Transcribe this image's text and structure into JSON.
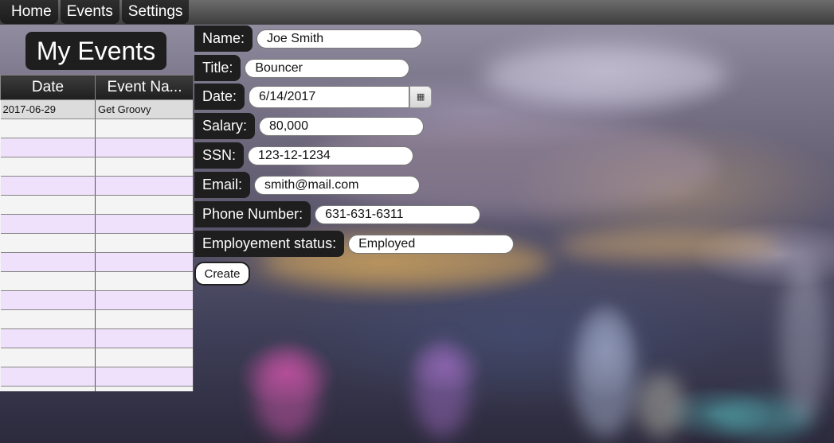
{
  "nav": {
    "items": [
      {
        "label": "Home"
      },
      {
        "label": "Events"
      },
      {
        "label": "Settings"
      }
    ]
  },
  "sidebar": {
    "title": "My Events",
    "table": {
      "headers": [
        "Date",
        "Event Na..."
      ],
      "rows": [
        [
          "2017-06-29",
          "Get Groovy"
        ],
        [
          "",
          ""
        ],
        [
          "",
          ""
        ],
        [
          "",
          ""
        ],
        [
          "",
          ""
        ],
        [
          "",
          ""
        ],
        [
          "",
          ""
        ],
        [
          "",
          ""
        ],
        [
          "",
          ""
        ],
        [
          "",
          ""
        ],
        [
          "",
          ""
        ],
        [
          "",
          ""
        ],
        [
          "",
          ""
        ],
        [
          "",
          ""
        ],
        [
          "",
          ""
        ],
        [
          "",
          ""
        ]
      ]
    }
  },
  "form": {
    "name_label": "Name:",
    "name_value": "Joe Smith",
    "title_label": "Title:",
    "title_value": "Bouncer",
    "date_label": "Date:",
    "date_value": "6/14/2017",
    "salary_label": "Salary:",
    "salary_value": "80,000",
    "ssn_label": "SSN:",
    "ssn_value": "123-12-1234",
    "email_label": "Email:",
    "email_value": "smith@mail.com",
    "phone_label": "Phone Number:",
    "phone_value": "631-631-6311",
    "status_label": "Employement status:",
    "status_value": "Employed",
    "create_label": "Create"
  },
  "icons": {
    "calendar": "calendar-icon"
  },
  "colors": {
    "label_bg": "#1e1e1e",
    "row_alt": "#efe0fb",
    "row_base": "#f4f4f4"
  }
}
